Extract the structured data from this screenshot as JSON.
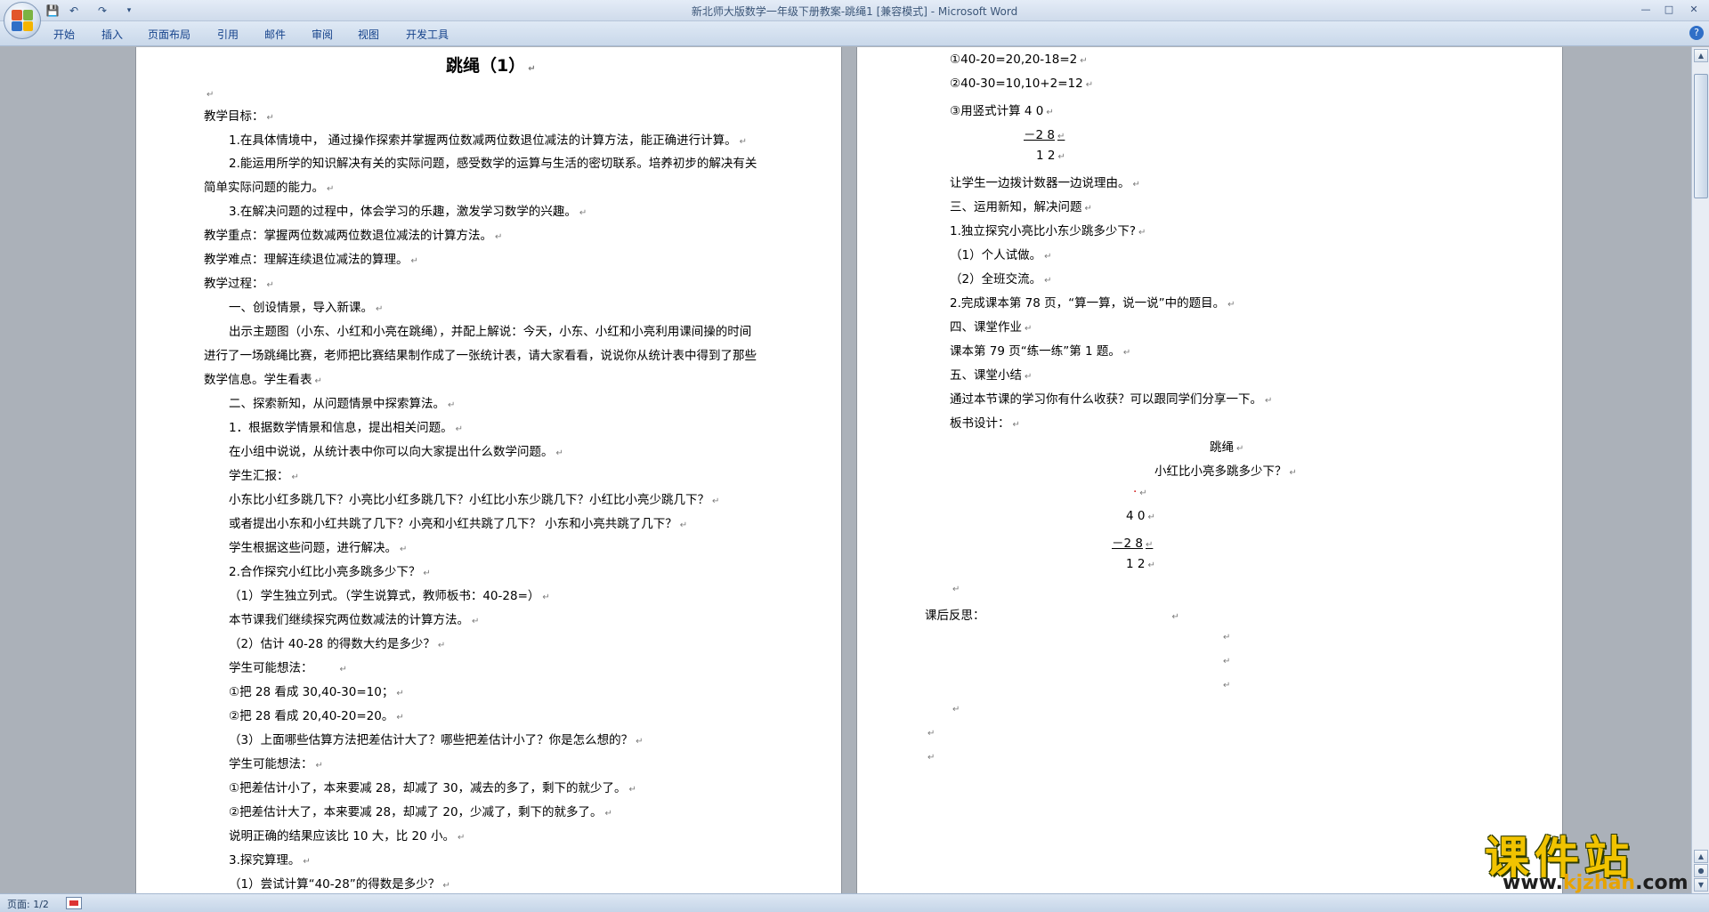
{
  "window": {
    "title": "新北师大版数学一年级下册教案-跳绳1 [兼容模式] - Microsoft Word",
    "tabs": [
      "开始",
      "插入",
      "页面布局",
      "引用",
      "邮件",
      "审阅",
      "视图",
      "开发工具"
    ],
    "help": "?"
  },
  "status": {
    "page": "页面: 1/2"
  },
  "watermark": {
    "cn": "课件站",
    "url_prefix": "www.",
    "url_domain": "kjzhan",
    "url_suffix": ".com"
  },
  "page1": {
    "lines": [
      "跳绳（1）",
      "",
      "教学目标：",
      "1.在具体情境中，  通过操作探索并掌握两位数减两位数退位减法的计算方法，能正确进行计算。",
      "2.能运用所学的知识解决有关的实际问题，感受数学的运算与生活的密切联系。培养初步的解决有关",
      "简单实际问题的能力。",
      "3.在解决问题的过程中，体会学习的乐趣，激发学习数学的兴趣。",
      "教学重点：掌握两位数减两位数退位减法的计算方法。",
      "教学难点：理解连续退位减法的算理。",
      "教学过程：",
      "一、创设情景，导入新课。",
      "出示主题图（小东、小红和小亮在跳绳），并配上解说：今天，小东、小红和小亮利用课间操的时间",
      "进行了一场跳绳比赛，老师把比赛结果制作成了一张统计表，请大家看看，说说你从统计表中得到了那些",
      "数学信息。学生看表",
      "二、探索新知，从问题情景中探索算法。",
      "1．根据数学情景和信息，提出相关问题。",
      "在小组中说说，从统计表中你可以向大家提出什么数学问题。",
      "学生汇报：",
      "小东比小红多跳几下？小亮比小红多跳几下？小红比小东少跳几下？小红比小亮少跳几下？",
      "或者提出小东和小红共跳了几下？小亮和小红共跳了几下？  小东和小亮共跳了几下？",
      "学生根据这些问题，进行解决。",
      "2.合作探究小红比小亮多跳多少下？",
      "（1）学生独立列式。（学生说算式，教师板书：40-28=）",
      "本节课我们继续探究两位数减法的计算方法。",
      "（2）估计 40-28 的得数大约是多少？",
      "学生可能想法：",
      "①把 28 看成 30,40-30=10；",
      "②把 28 看成 20,40-20=20。",
      "（3）上面哪些估算方法把差估计大了？哪些把差估计小了？你是怎么想的？",
      "学生可能想法：",
      "①把差估计小了，本来要减 28，却减了 30，减去的多了，剩下的就少了。",
      "②把差估计大了，本来要减 28，却减了 20，少减了，剩下的就多了。",
      "说明正确的结果应该比 10 大，比 20 小。",
      "3.探究算理。",
      "（1）尝试计算“40-28”的得数是多少？"
    ]
  },
  "page2": {
    "lines": [
      "①40-20=20,20-18=2",
      "②40-30=10,10+2=12",
      "③用竖式计算   4    0",
      "－2    8",
      "1    2",
      "让学生一边拨计数器一边说理由。",
      "三、运用新知，解决问题",
      "1.独立探究小亮比小东少跳多少下?",
      "（1）个人试做。",
      "（2）全班交流。",
      "2.完成课本第 78 页，“算一算，说一说”中的题目。",
      "四、课堂作业",
      "课本第 79 页“练一练”第 1 题。",
      "五、课堂小结",
      "通过本节课的学习你有什么收获？可以跟同学们分享一下。",
      "板书设计：",
      "跳绳",
      "小红比小亮多跳多少下？",
      "·",
      "4    0",
      "－2    8",
      "1    2",
      "",
      "课后反思：",
      "",
      "",
      "",
      "",
      "",
      ""
    ]
  }
}
